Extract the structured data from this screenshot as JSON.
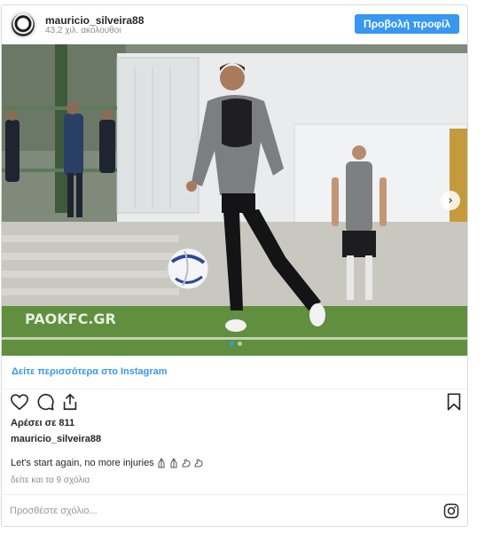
{
  "header": {
    "username": "mauricio_silveira88",
    "followers": "43.2 χιλ. ακόλουθοι",
    "profile_button": "Προβολή προφίλ"
  },
  "photo": {
    "watermark": "PAOKFC.GR",
    "carousel_total": 2,
    "carousel_active": 1
  },
  "view_more": "Δείτε περισσότερα στο Instagram",
  "actions": {
    "icons": [
      "heart-icon",
      "comment-icon",
      "share-icon",
      "bookmark-icon"
    ]
  },
  "likes": "Αρέσει σε 811",
  "caption": {
    "username": "mauricio_silveira88",
    "text": "Let's start again, no more injuries",
    "emojis": [
      "praying-hands",
      "praying-hands",
      "flexed-biceps",
      "flexed-biceps"
    ]
  },
  "comments_link": "δείτε και τα 9 σχόλια",
  "comment_input": {
    "placeholder": "Προσθέστε σχόλιο..."
  },
  "colors": {
    "accent": "#3897f0",
    "text": "#262626",
    "muted": "#8e8e8e",
    "border": "#dbdbdb"
  }
}
